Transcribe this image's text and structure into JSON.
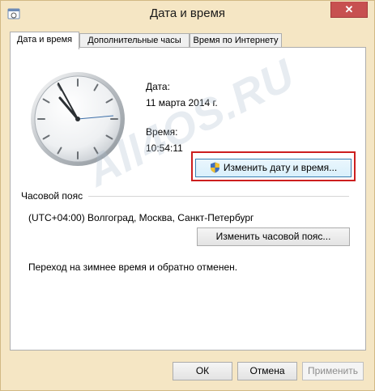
{
  "window": {
    "title": "Дата и время",
    "close_glyph": "✕"
  },
  "tabs": [
    {
      "label": "Дата и время",
      "active": true
    },
    {
      "label": "Дополнительные часы",
      "active": false
    },
    {
      "label": "Время по Интернету",
      "active": false
    }
  ],
  "datetime": {
    "date_label": "Дата:",
    "date_value": "11 марта 2014 г.",
    "time_label": "Время:",
    "time_value": "10:54:11",
    "change_button": "Изменить дату и время..."
  },
  "timezone": {
    "section_label": "Часовой пояс",
    "value": "(UTC+04:00) Волгоград, Москва, Санкт-Петербург",
    "change_button": "Изменить часовой пояс..."
  },
  "dst_note": "Переход на зимнее время и обратно отменен.",
  "footer": {
    "ok": "ОК",
    "cancel": "Отмена",
    "apply": "Применить"
  },
  "watermark": "All4OS.RU",
  "icons": {
    "clock": "analog-clock-icon",
    "shield": "uac-shield-icon",
    "app": "datetime-app-icon"
  },
  "colors": {
    "title_frame": "#f5e6c4",
    "close_button": "#c75050",
    "highlight": "#cc1f1f"
  }
}
